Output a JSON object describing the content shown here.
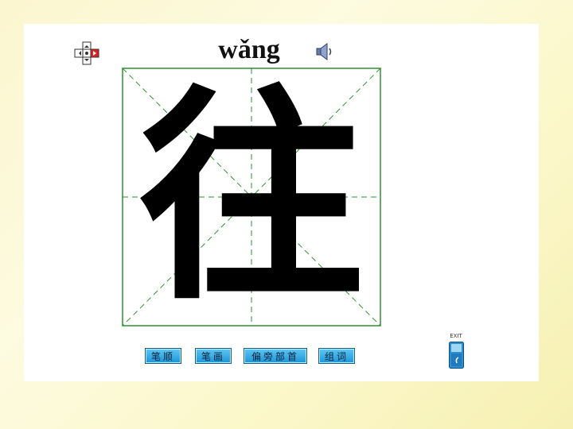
{
  "character": {
    "pinyin": "wǎng",
    "hanzi": "往"
  },
  "toolbar": {
    "stroke_order_label": "笔顺",
    "strokes_label": "笔画",
    "radical_label": "偏旁部首",
    "words_label": "组词"
  },
  "exit": {
    "label": "EXIT"
  },
  "colors": {
    "grid": "#2f8f2f",
    "button": "#1b95d7",
    "background": "#fbf6cf"
  },
  "icons": {
    "nav": "quad-arrow-nav-icon",
    "sound": "speaker-icon",
    "exit": "exit-door-icon"
  }
}
